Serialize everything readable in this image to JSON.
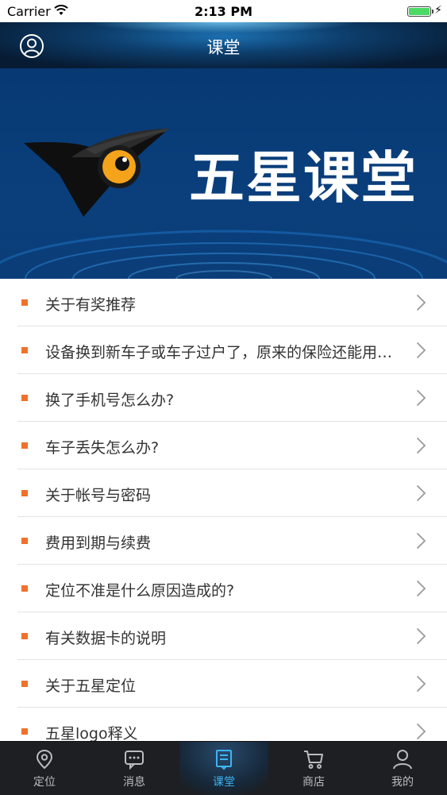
{
  "status_bar": {
    "carrier": "Carrier",
    "time": "2:13 PM",
    "battery_color": "#4cd964"
  },
  "nav": {
    "title": "课堂",
    "left_icon": "user-icon"
  },
  "banner": {
    "title": "五星课堂",
    "logo_icon": "eye-logo-icon",
    "background": "#073a73"
  },
  "list": {
    "bullet_color": "#f0712c",
    "items": [
      {
        "label": "关于有奖推荐"
      },
      {
        "label": "设备换到新车子或车子过户了，原来的保险还能用吗？"
      },
      {
        "label": "换了手机号怎么办?"
      },
      {
        "label": "车子丢失怎么办?"
      },
      {
        "label": "关于帐号与密码"
      },
      {
        "label": "费用到期与续费"
      },
      {
        "label": "定位不准是什么原因造成的?"
      },
      {
        "label": "有关数据卡的说明"
      },
      {
        "label": "关于五星定位"
      },
      {
        "label": "五星logo释义"
      }
    ]
  },
  "tab_bar": {
    "active_color": "#3db3f2",
    "tabs": [
      {
        "label": "定位",
        "icon": "location-pin-icon"
      },
      {
        "label": "消息",
        "icon": "message-icon"
      },
      {
        "label": "课堂",
        "icon": "classroom-icon",
        "active": true
      },
      {
        "label": "商店",
        "icon": "cart-icon"
      },
      {
        "label": "我的",
        "icon": "profile-icon"
      }
    ]
  }
}
